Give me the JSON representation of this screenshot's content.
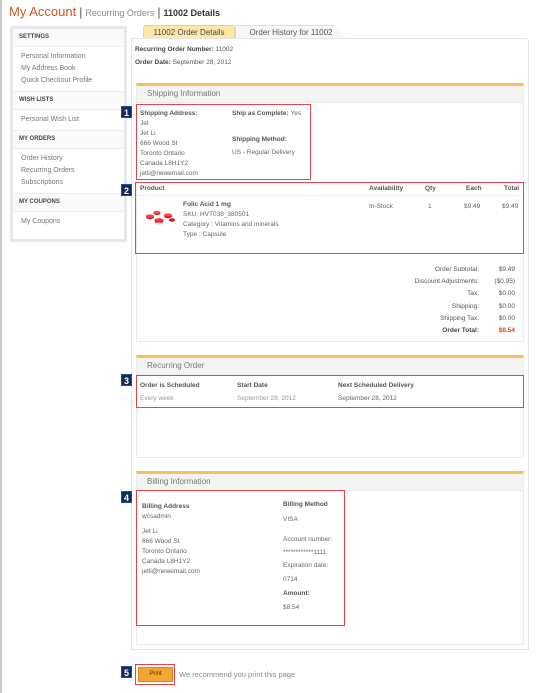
{
  "header": {
    "title": "My Account",
    "crumb_recurring": "Recurring Orders",
    "crumb_current": "11002 Details"
  },
  "sidebar": {
    "sections": [
      {
        "heading": "SETTINGS",
        "items": [
          "Personal Information",
          "My Address Book",
          "Quick Checkout Profile"
        ]
      },
      {
        "heading": "WISH LISTS",
        "items": [
          "Personal Wish List"
        ]
      },
      {
        "heading": "MY ORDERS",
        "items": [
          "Order History",
          "Recurring Orders",
          "Subscriptions"
        ]
      },
      {
        "heading": "MY COUPONS",
        "items": [
          "My Coupons"
        ]
      }
    ]
  },
  "tabs": {
    "active": "11002 Order Details",
    "other": "Order History for 11002"
  },
  "order_meta": {
    "number_label": "Recurring Order Number:",
    "number_value": "11002",
    "date_label": "Order Date:",
    "date_value": "September 28, 2012"
  },
  "shipping": {
    "section_title": "Shipping Information",
    "address_label": "Shipping Address:",
    "address_lines": [
      "Jet",
      "Jet Li",
      "666 Wood St",
      "Toronto Ontario",
      "Canada L8H1Y2",
      "jetli@newemail.com"
    ],
    "ship_complete_label": "Ship as Complete:",
    "ship_complete_value": "Yes",
    "method_label": "Shipping Method:",
    "method_value": "US - Regular Delivery"
  },
  "product_table": {
    "headers": {
      "product": "Product",
      "availability": "Availability",
      "qty": "Qty",
      "each": "Each",
      "total": "Total"
    },
    "rows": [
      {
        "name": "Folic Acid 1 mg",
        "sku": "SKU: HVT038_380501",
        "category": "Category : Vitamins and minerals",
        "type": "Type : Capsule",
        "availability": "In-Stock",
        "qty": "1",
        "each": "$9.49",
        "total": "$9.49",
        "image_icon": "pill-capsules-image"
      }
    ]
  },
  "totals": [
    {
      "label": "Order Subtotal:",
      "value": "$9.49"
    },
    {
      "label": "Discount Adjustments:",
      "value": "($0.95)"
    },
    {
      "label": "Tax:",
      "value": "$0.00"
    },
    {
      "label": "Shipping:",
      "value": "$0.00"
    },
    {
      "label": "Shipping Tax:",
      "value": "$0.00"
    },
    {
      "label": "Order Total:",
      "value": "$8.54"
    }
  ],
  "recurring": {
    "section_title": "Recurring Order",
    "scheduled_label": "Order is Scheduled",
    "scheduled_value": "Every week",
    "start_label": "Start Date",
    "start_value": "September 28, 2012",
    "next_label": "Next Scheduled Delivery",
    "next_value": "September 28, 2012"
  },
  "billing": {
    "section_title": "Billing Information",
    "address_label": "Billing Address",
    "nickname": "wcsadmin",
    "address_lines": [
      "Jet Li",
      "666 Wood St",
      "Toronto Ontario",
      "Canada L8H1Y2",
      "jetli@newemail.com"
    ],
    "method_label": "Billing Method",
    "method_value": "VISA",
    "account_label": "Account number:",
    "account_value": "************1111",
    "expiry_label": "Expiration date:",
    "expiry_value": "0714",
    "amount_label": "Amount:",
    "amount_value": "$8.54"
  },
  "footer": {
    "print_label": "Print",
    "print_hint": "We recommend you print this page"
  },
  "callouts": [
    "1",
    "2",
    "3",
    "4",
    "5"
  ],
  "colors": {
    "accent": "#d2561d",
    "section_bar": "#f7c25a",
    "callout_border": "#e8424a",
    "callout_badge": "#0e2b5c",
    "print_button": "#f6a534",
    "order_total": "#e0481d"
  }
}
